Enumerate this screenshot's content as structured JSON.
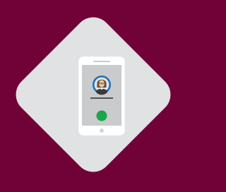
{
  "colors": {
    "background": "#710238",
    "card": "#e1e2e3",
    "phone_body": "#ffffff",
    "phone_screen": "#c9cbcc",
    "avatar_ring": "#1e6fb5",
    "call_button": "#1aa64a",
    "name_line": "#555555"
  },
  "icons": {
    "phone": "smartphone-icon",
    "avatar": "user-avatar-icon",
    "call": "call-button-icon"
  }
}
